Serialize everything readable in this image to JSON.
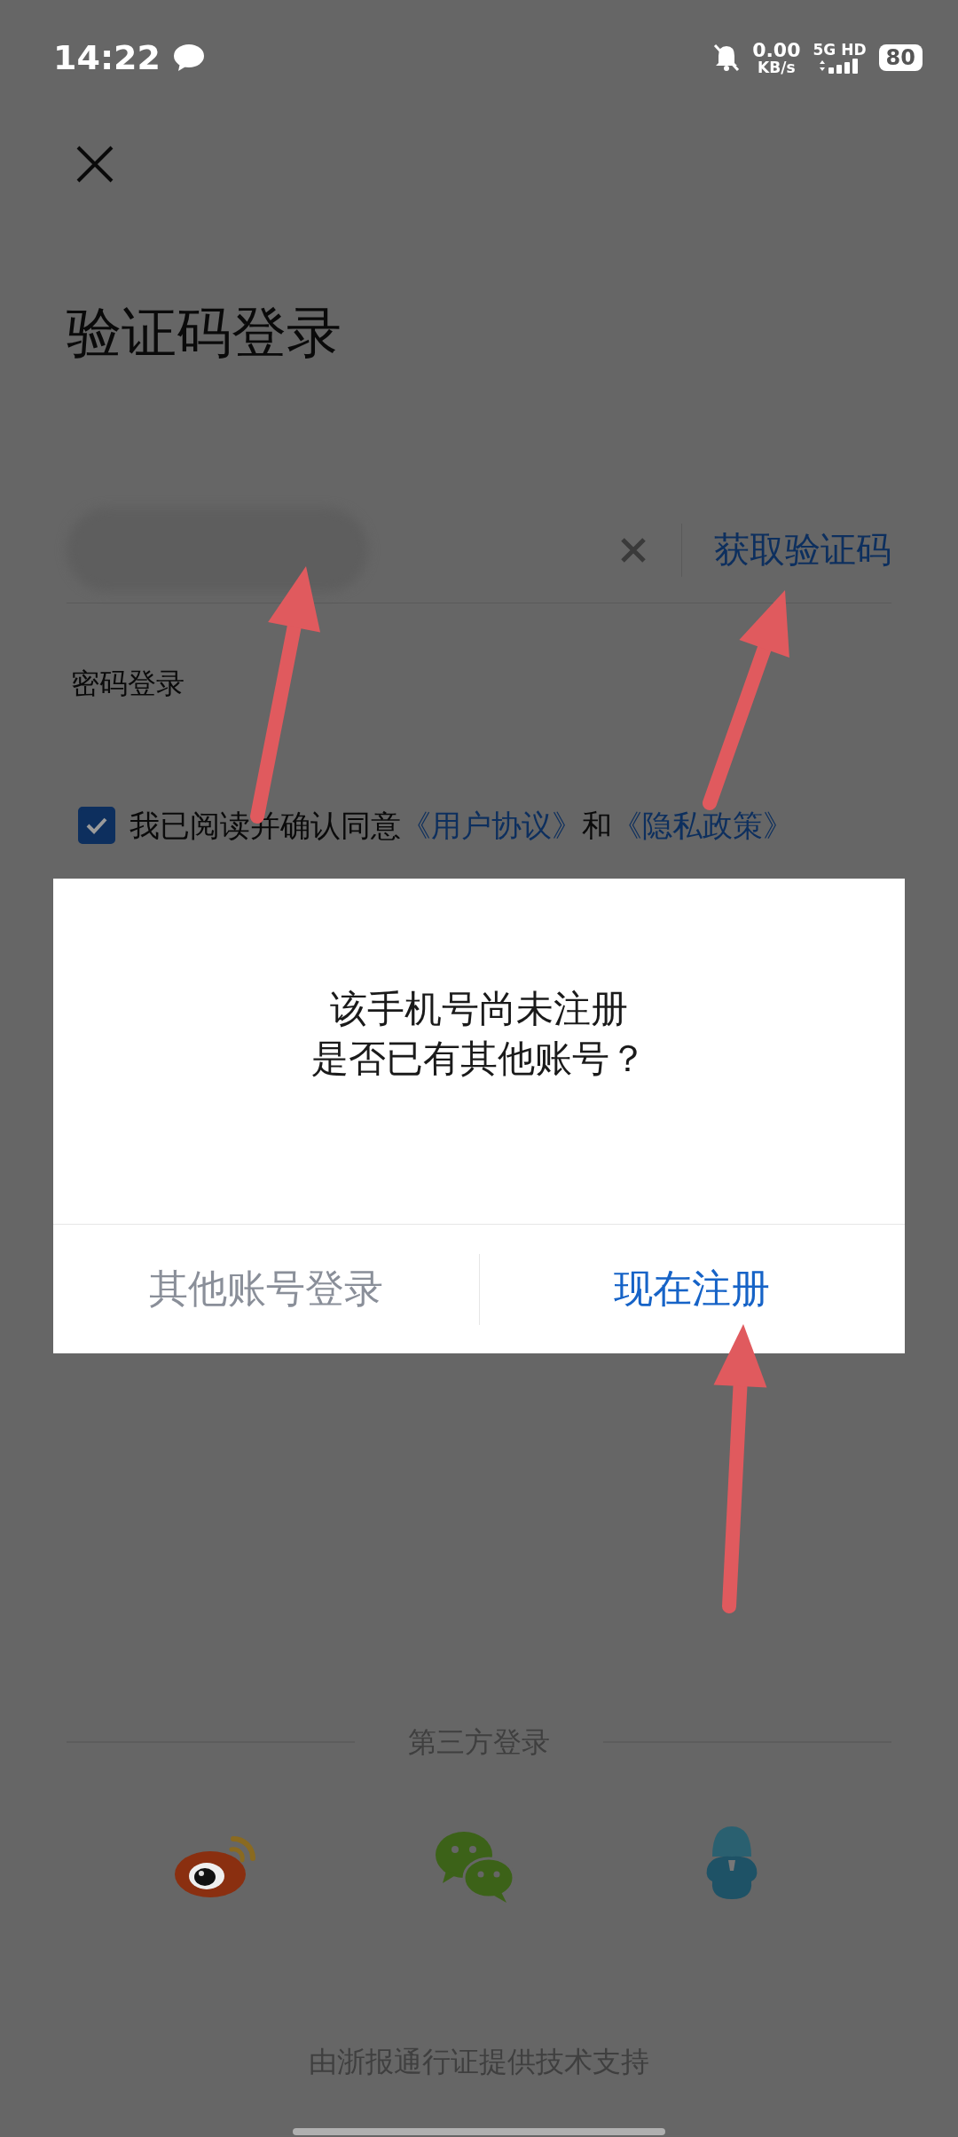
{
  "status_bar": {
    "time": "14:22",
    "net_speed": "0.00",
    "net_unit": "KB/s",
    "network": "5G",
    "hd": "HD",
    "battery": "80"
  },
  "title": "验证码登录",
  "phone_field": {
    "action": "获取验证码"
  },
  "password_login": "密码登录",
  "agreement": {
    "checked": true,
    "prefix": "我已阅读并确认同意",
    "links": [
      "《用户协议》",
      "《隐私政策》"
    ],
    "joiner": "和"
  },
  "dialog": {
    "message_lines": [
      "该手机号尚未注册",
      "是否已有其他账号？"
    ],
    "buttons": [
      {
        "label": "其他账号登录",
        "primary": false
      },
      {
        "label": "现在注册",
        "primary": true
      }
    ]
  },
  "third_party": {
    "heading": "第三方登录",
    "providers": [
      {
        "kind": "weibo"
      },
      {
        "kind": "wechat"
      },
      {
        "kind": "qq"
      }
    ]
  },
  "footer": "由浙报通行证提供技术支持"
}
